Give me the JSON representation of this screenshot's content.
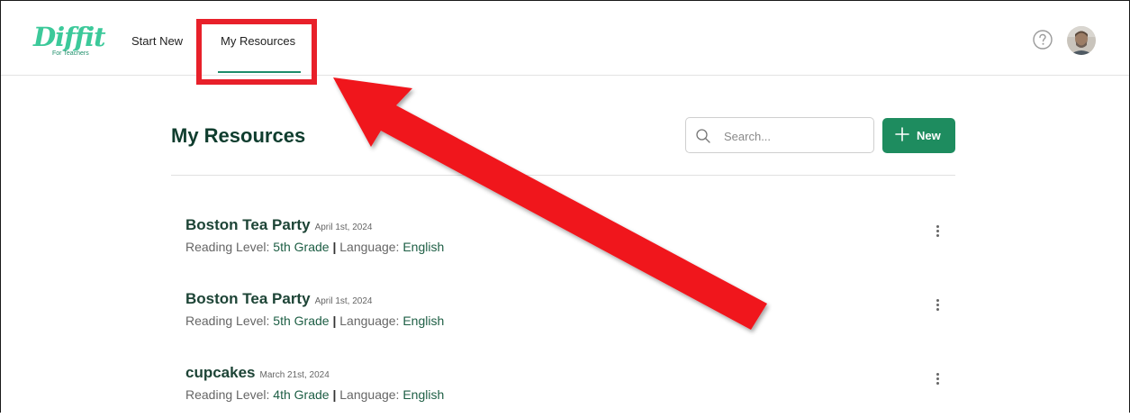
{
  "header": {
    "logo_text": "Diffit",
    "logo_subtitle": "For Teachers",
    "nav": {
      "start_new": "Start New",
      "my_resources": "My Resources"
    },
    "help_icon": "question-circle-icon",
    "avatar_icon": "user-avatar"
  },
  "main": {
    "title": "My Resources",
    "search_placeholder": "Search...",
    "new_button_label": "New",
    "items": [
      {
        "title": "Boston Tea Party",
        "date": "April 1st, 2024",
        "level_label": "Reading Level:",
        "level": "5th Grade",
        "lang_label": "Language:",
        "lang": "English"
      },
      {
        "title": "Boston Tea Party",
        "date": "April 1st, 2024",
        "level_label": "Reading Level:",
        "level": "5th Grade",
        "lang_label": "Language:",
        "lang": "English"
      },
      {
        "title": "cupcakes",
        "date": "March 21st, 2024",
        "level_label": "Reading Level:",
        "level": "4th Grade",
        "lang_label": "Language:",
        "lang": "English"
      }
    ],
    "separator": "|"
  },
  "colors": {
    "brand_green": "#3cc99a",
    "button_green": "#1e8c5f",
    "title_green": "#0f3d2e",
    "annotation_red": "#e8202a"
  }
}
